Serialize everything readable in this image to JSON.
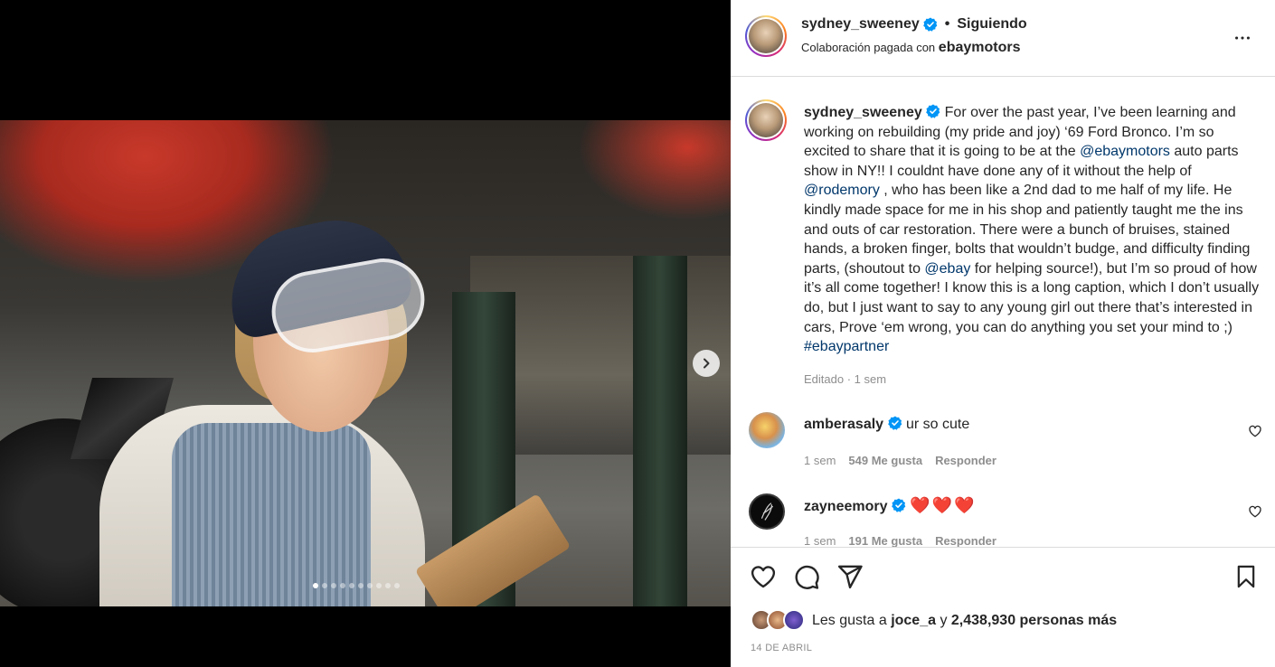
{
  "post": {
    "username": "sydney_sweeney",
    "follow_label": "Siguiendo",
    "separator": "•",
    "paid_partnership_prefix": "Colaboración pagada con",
    "partner": "ebaymotors",
    "carousel": {
      "total_slides": 10,
      "current_slide": 1
    }
  },
  "caption": {
    "username": "sydney_sweeney",
    "part1": " For over the past year, I’ve been learning and working on rebuilding (my pride and joy) ‘69 Ford Bronco. I’m so excited to share that it is going to be at the ",
    "mention1": "@ebaymotors",
    "part2": " auto parts show in NY!! I couldnt have done any of it without the help of ",
    "mention2": "@rodemory",
    "part3": " , who has been like a 2nd dad to me half of my life. He kindly made space for me in his shop and patiently taught me the ins and outs of car restoration. There were a bunch of bruises, stained hands, a broken finger, bolts that wouldn’t budge, and difficulty finding parts, (shoutout to ",
    "mention3": "@ebay",
    "part4": " for helping source!), but I’m so proud of how it’s all come together! I know this is a long caption, which I don’t usually do, but I just want to say to any young girl out there that’s interested in cars, Prove ‘em wrong, you can do anything you set your mind to ;) ",
    "hashtag": "#ebaypartner",
    "meta": "Editado · 1 sem"
  },
  "comments": [
    {
      "username": "amberasaly",
      "text": "ur so cute",
      "time": "1 sem",
      "likes": "549 Me gusta",
      "reply": "Responder"
    },
    {
      "username": "zayneemory",
      "text": "❤️❤️❤️",
      "time": "1 sem",
      "likes": "191 Me gusta",
      "reply": "Responder"
    }
  ],
  "likes": {
    "prefix": "Les gusta a",
    "user": "joce_a",
    "conj": "y",
    "others": "2,438,930 personas más"
  },
  "date": "14 DE ABRIL",
  "colors": {
    "accent": "#0095f6",
    "link": "#00376b",
    "verified": "#0095f6"
  }
}
